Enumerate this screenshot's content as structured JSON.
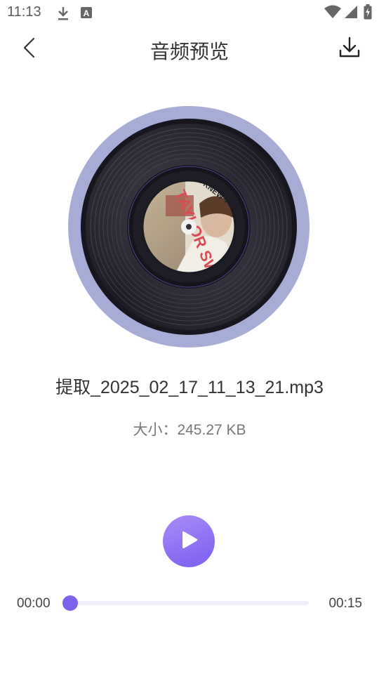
{
  "status_bar": {
    "time": "11:13",
    "left_icons": [
      "download-arrow-icon",
      "app-letter-a-icon"
    ],
    "right_icons": [
      "wifi-icon",
      "cellular-signal-icon",
      "battery-icon"
    ]
  },
  "header": {
    "title": "音频预览",
    "back_icon": "chevron-left-icon",
    "download_icon": "download-tray-icon"
  },
  "player": {
    "cover": {
      "text_lines": [
        "I KNEW YOU WERE TROUBLE",
        "TAYLOR SWIFT"
      ]
    },
    "file_name": "提取_2025_02_17_11_13_21.mp3",
    "size_label": "大小：",
    "size_value": "245.27 KB",
    "current_time": "00:00",
    "total_time": "00:15",
    "progress": 0.0,
    "play_icon": "play-icon"
  },
  "colors": {
    "accent": "#7d62ee",
    "accent_light": "#a98bf7",
    "disc_ring": "#a7acd6",
    "disc_body": "#23222c",
    "track": "#f0eef8"
  }
}
